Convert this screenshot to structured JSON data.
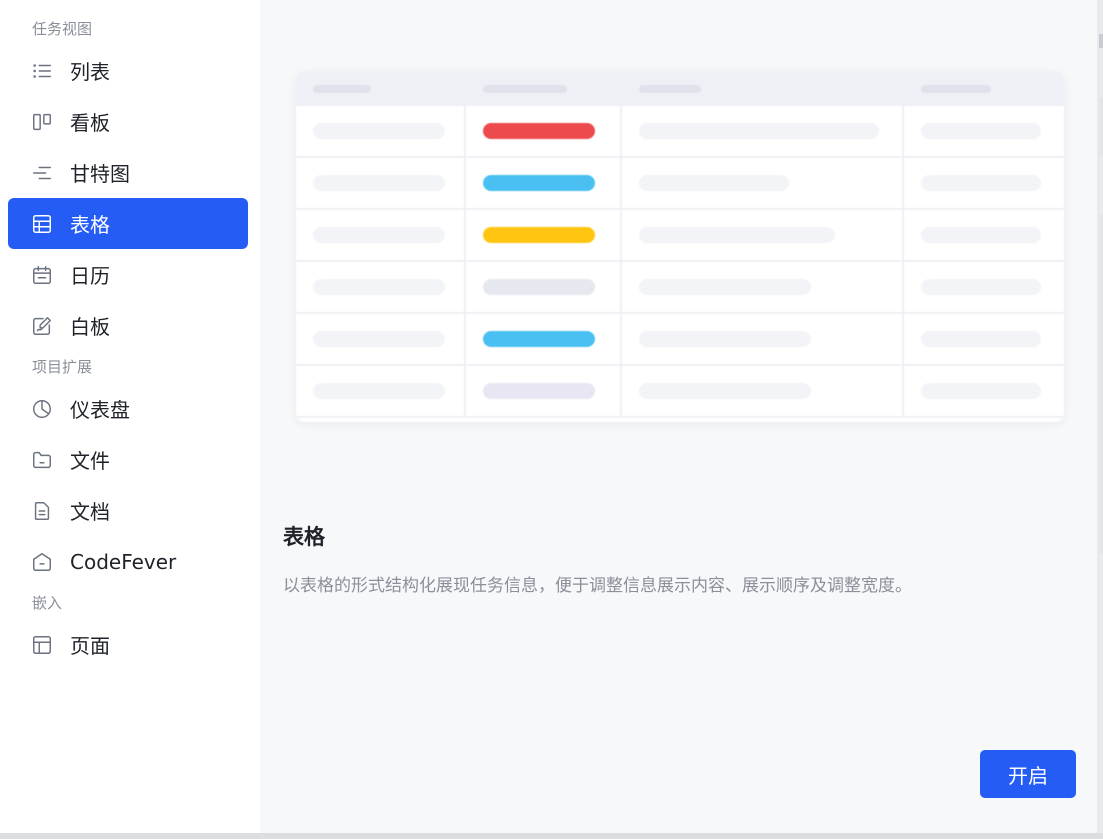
{
  "sidebar": {
    "groups": [
      {
        "title": "任务视图",
        "items": [
          {
            "label": "列表",
            "icon": "list-icon"
          },
          {
            "label": "看板",
            "icon": "kanban-icon"
          },
          {
            "label": "甘特图",
            "icon": "gantt-icon"
          },
          {
            "label": "表格",
            "icon": "table-icon",
            "active": true
          },
          {
            "label": "日历",
            "icon": "calendar-icon"
          },
          {
            "label": "白板",
            "icon": "whiteboard-icon"
          }
        ]
      },
      {
        "title": "项目扩展",
        "items": [
          {
            "label": "仪表盘",
            "icon": "dashboard-icon"
          },
          {
            "label": "文件",
            "icon": "folder-icon"
          },
          {
            "label": "文档",
            "icon": "document-icon"
          },
          {
            "label": "CodeFever",
            "icon": "codefever-icon"
          }
        ]
      },
      {
        "title": "嵌入",
        "items": [
          {
            "label": "页面",
            "icon": "page-icon"
          }
        ]
      }
    ]
  },
  "detail": {
    "title": "表格",
    "description": "以表格的形式结构化展现任务信息，便于调整信息展示内容、展示顺序及调整宽度。",
    "button_label": "开启"
  },
  "preview": {
    "status_colors": [
      "#ec4a4d",
      "#4ac0f2",
      "#ffc511",
      "#e6e8ef",
      "#4ac0f2",
      "#e8e6f2"
    ]
  },
  "colors": {
    "accent": "#245cf5",
    "background": "#f7f8fa",
    "muted_text": "#8a8f99"
  }
}
